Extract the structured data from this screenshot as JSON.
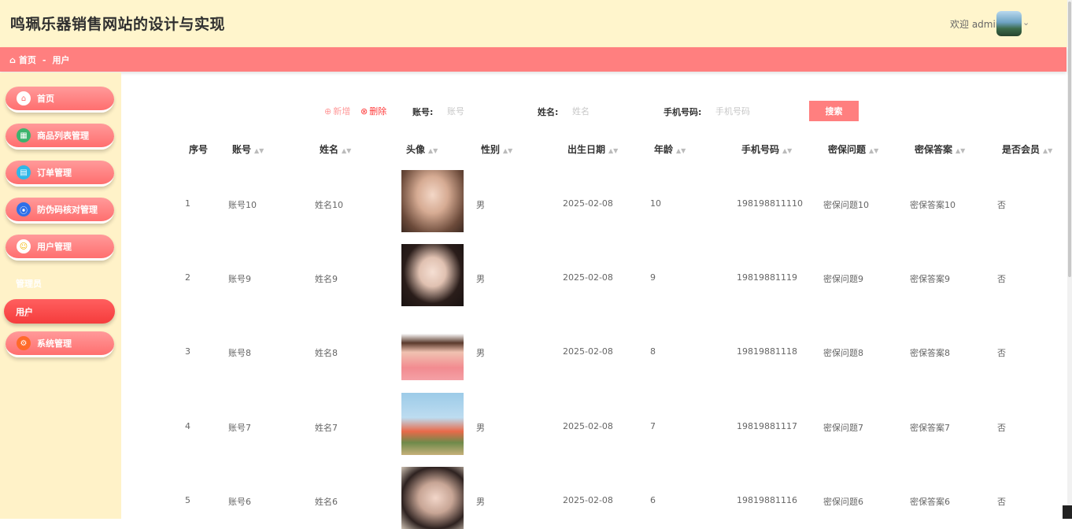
{
  "header": {
    "title": "鸣珮乐器销售网站的设计与实现",
    "welcome": "欢迎 admin",
    "avatar_alt": "admin avatar"
  },
  "breadcrumb": {
    "home": "首页",
    "separator": "-",
    "current": "用户"
  },
  "sidebar": {
    "items": [
      {
        "label": "首页",
        "icon": "home-icon"
      },
      {
        "label": "商品列表管理",
        "icon": "grid-icon"
      },
      {
        "label": "订单管理",
        "icon": "order-icon"
      },
      {
        "label": "防伪码核对管理",
        "icon": "compass-icon"
      },
      {
        "label": "用户管理",
        "icon": "user-icon"
      }
    ],
    "sub_title": "管理员",
    "sub_active": "用户",
    "last_item": {
      "label": "系统管理",
      "icon": "settings-icon"
    }
  },
  "toolbar": {
    "add_label": "新增",
    "delete_label": "删除",
    "account_label": "账号:",
    "account_placeholder": "账号",
    "name_label": "姓名:",
    "name_placeholder": "姓名",
    "phone_label": "手机号码:",
    "phone_placeholder": "手机号码",
    "search_label": "搜索"
  },
  "table": {
    "columns": [
      "序号",
      "账号",
      "姓名",
      "头像",
      "性别",
      "出生日期",
      "年龄",
      "手机号码",
      "密保问题",
      "密保答案",
      "是否会员"
    ],
    "rows": [
      {
        "index": "1",
        "account": "账号10",
        "name": "姓名10",
        "gender": "男",
        "birth": "2025-02-08",
        "age": "10",
        "phone": "198198811110",
        "question": "密保问题10",
        "answer": "密保答案10",
        "member": "否"
      },
      {
        "index": "2",
        "account": "账号9",
        "name": "姓名9",
        "gender": "男",
        "birth": "2025-02-08",
        "age": "9",
        "phone": "19819881119",
        "question": "密保问题9",
        "answer": "密保答案9",
        "member": "否"
      },
      {
        "index": "3",
        "account": "账号8",
        "name": "姓名8",
        "gender": "男",
        "birth": "2025-02-08",
        "age": "8",
        "phone": "19819881118",
        "question": "密保问题8",
        "answer": "密保答案8",
        "member": "否"
      },
      {
        "index": "4",
        "account": "账号7",
        "name": "姓名7",
        "gender": "男",
        "birth": "2025-02-08",
        "age": "7",
        "phone": "19819881117",
        "question": "密保问题7",
        "answer": "密保答案7",
        "member": "否"
      },
      {
        "index": "5",
        "account": "账号6",
        "name": "姓名6",
        "gender": "男",
        "birth": "2025-02-08",
        "age": "6",
        "phone": "19819881116",
        "question": "密保问题6",
        "answer": "密保答案6",
        "member": "否"
      }
    ]
  },
  "colors": {
    "header_bg": "#fff5cc",
    "accent": "#ff7f7f",
    "active": "#f53c3c",
    "sidebar_bg": "#fff2c8"
  }
}
